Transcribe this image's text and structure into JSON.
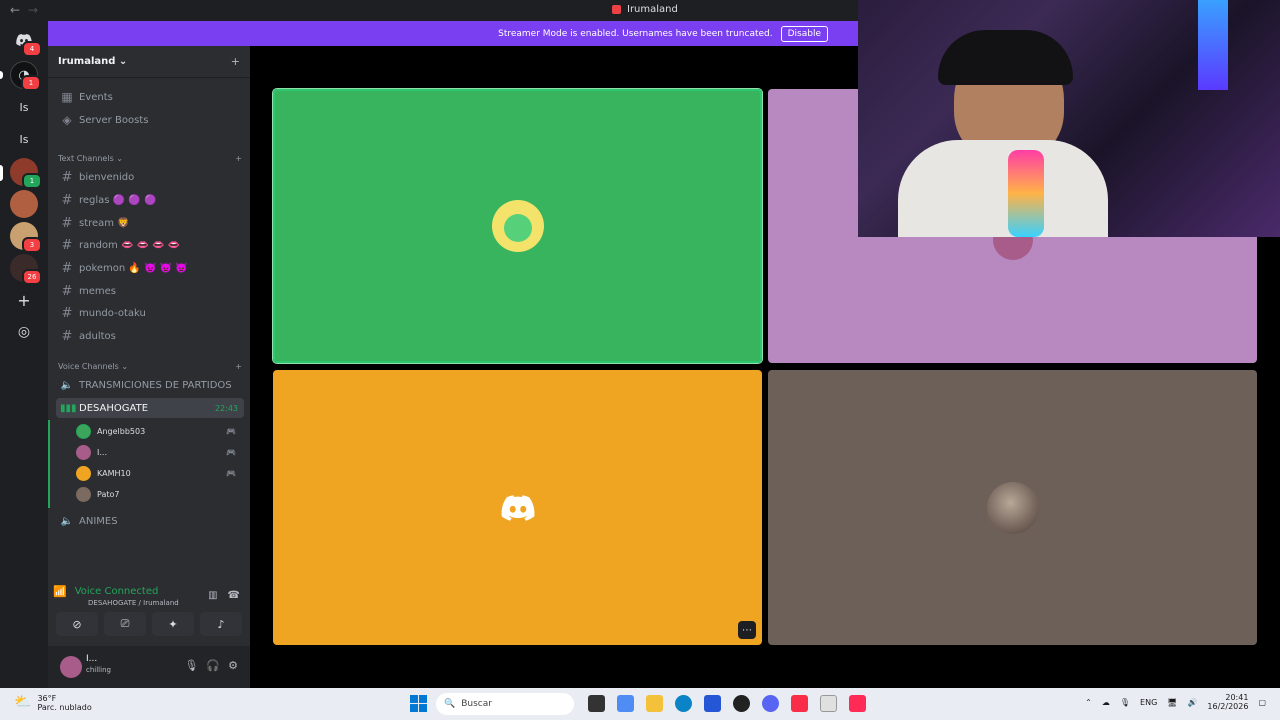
{
  "window": {
    "title": "Irumaland",
    "back_glyph": "←",
    "forward_glyph": "→"
  },
  "banner": {
    "message": "Streamer Mode is enabled. Usernames have been truncated.",
    "disable_label": "Disable"
  },
  "rail": {
    "servers": [
      {
        "label": "",
        "badge": "4",
        "color": "#1e1f22"
      },
      {
        "label": "",
        "badge": "1",
        "color": "#111214"
      },
      {
        "label": "Is",
        "badge": "",
        "color": "#1e1f22"
      },
      {
        "label": "Is",
        "badge": "",
        "color": "#1e1f22"
      },
      {
        "label": "",
        "badge": "1",
        "color": "#8e3b2c"
      },
      {
        "label": "",
        "badge": "",
        "color": "#b06040"
      },
      {
        "label": "",
        "badge": "3",
        "color": "#c9a070"
      },
      {
        "label": "",
        "badge": "26",
        "color": "#3a2a2a"
      }
    ],
    "add_glyph": "+",
    "discover_glyph": "◎"
  },
  "server": {
    "name": "Irumaland",
    "invite_glyph": "+",
    "items": [
      {
        "label": "Events",
        "icon": "calendar-icon"
      },
      {
        "label": "Server Boosts",
        "icon": "boost-icon"
      }
    ]
  },
  "text_category": {
    "label": "Text Channels",
    "add": "+"
  },
  "text_channels": [
    "bienvenido",
    "reglas 🟣 🟣 🟣",
    "stream 🦁",
    "random 👄 👄 👄 👄",
    "pokemon 🔥 👿 👿 👿",
    "memes",
    "mundo-otaku",
    "adultos"
  ],
  "voice_category": {
    "label": "Voice Channels",
    "add": "+"
  },
  "voice_channels": {
    "first": "TRANSMICIONES DE PARTIDOS",
    "active": "DESAHOGATE",
    "active_time": "22:43",
    "last": "ANIMES"
  },
  "voice_users": [
    {
      "name": "Angelbb503",
      "color": "#3ba55c",
      "status": "🎮"
    },
    {
      "name": "I...",
      "color": "#a75c8a",
      "status": "🎮"
    },
    {
      "name": "KAMH10",
      "color": "#f0a522",
      "status": "🎮"
    },
    {
      "name": "Pato7",
      "color": "#7b6a60",
      "status": ""
    }
  ],
  "voice_panel": {
    "status": "Voice Connected",
    "location": "DESAHOGATE / Irumaland"
  },
  "user_panel": {
    "name": "I...",
    "status": "chilling"
  },
  "taskbar": {
    "temp": "36°F",
    "weather": "Parc. nublado",
    "search": "Buscar",
    "lang": "ENG",
    "time": "20:41",
    "date": "16/2/2026"
  },
  "colors": {
    "tile_green": "#38b45f",
    "tile_lilac": "#b889c1",
    "tile_orange": "#f0a522",
    "tile_brown": "#6d6058",
    "speaking": "#23a55a"
  }
}
